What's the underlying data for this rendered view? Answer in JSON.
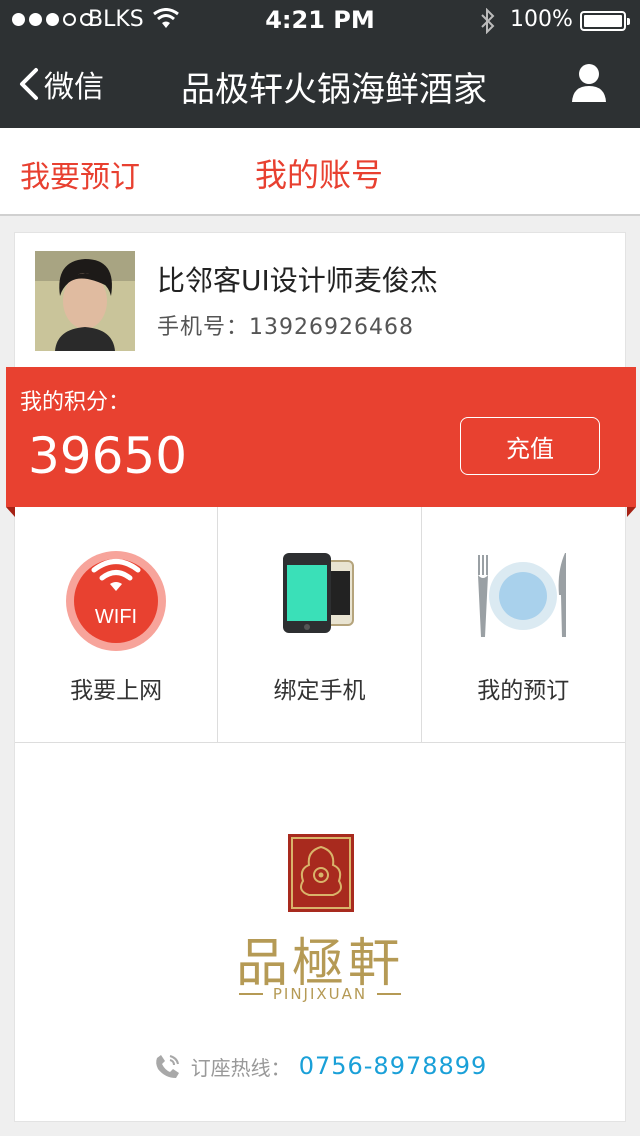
{
  "status_bar": {
    "carrier": "BLKS",
    "time": "4:21 PM",
    "battery": "100%"
  },
  "nav": {
    "back_label": "微信",
    "title": "品极轩火锅海鲜酒家"
  },
  "tabs": [
    {
      "label": "我要预订"
    },
    {
      "label": "我的账号"
    }
  ],
  "user": {
    "name": "比邻客UI设计师麦俊杰",
    "phone_label": "手机号：",
    "phone": "13926926468"
  },
  "points": {
    "label": "我的积分：",
    "value": "39650",
    "recharge_label": "充值"
  },
  "features": [
    {
      "label": "我要上网",
      "icon_text": "WIFI",
      "icon": "wifi-icon"
    },
    {
      "label": "绑定手机",
      "icon": "phone-icon"
    },
    {
      "label": "我的预订",
      "icon": "plate-icon"
    }
  ],
  "brand": {
    "name_cn": "品極軒",
    "name_en": "PINJIXUAN"
  },
  "hotline": {
    "label": "订座热线：",
    "number": "0756-8978899"
  },
  "colors": {
    "accent": "#e84130",
    "nav_bg": "#2d3133",
    "gold": "#b59a55",
    "link": "#1aa0d8"
  }
}
